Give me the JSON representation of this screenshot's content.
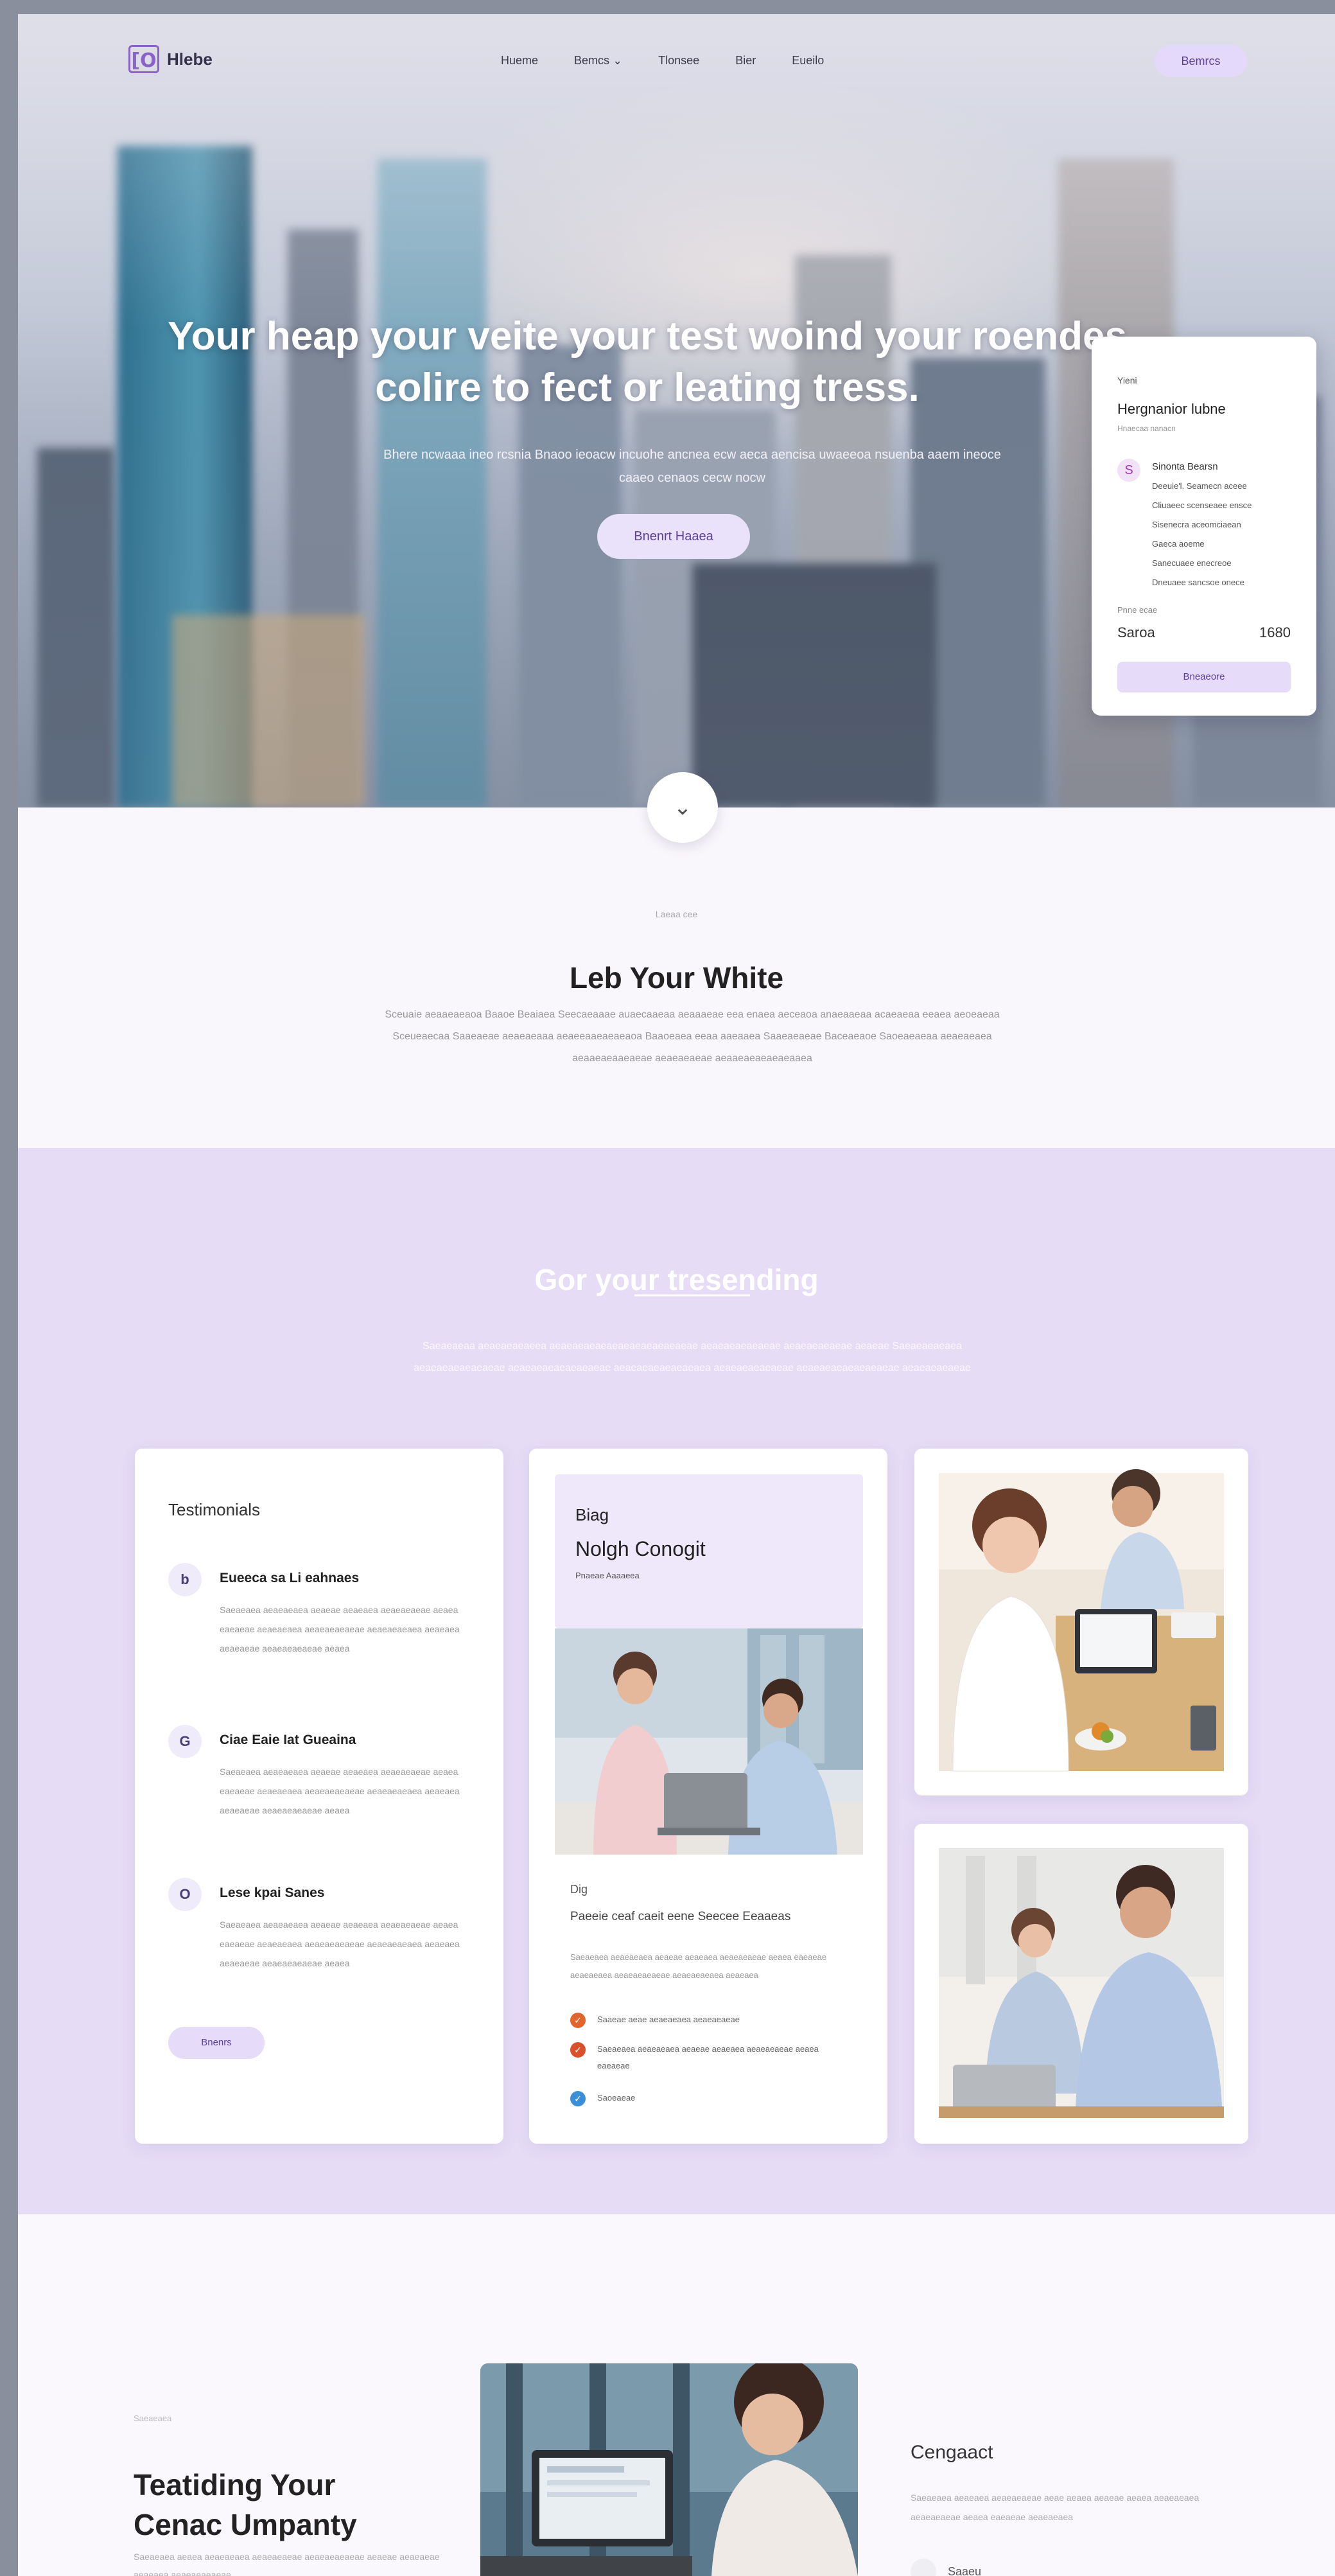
{
  "nav": {
    "logo_mark": "[O",
    "brand": "Hlebe",
    "links": [
      "Hueme",
      "Bemcs",
      "Tlonsee",
      "Bier",
      "Eueilo"
    ],
    "dropdown_chevron": "chevron-down-icon",
    "cta": "Bemrcs"
  },
  "hero": {
    "title": "Your heap your veite your test woind your roendes colire to fect or leating tress.",
    "subtitle": "Bhere ncwaaa ineo rcsnia Bnaoo ieoacw incuohe ancnea ecw aeca aencisa uwaeeoa nsuenba aaem ineoce caaeo cenaos cecw nocw",
    "cta": "Bnenrt Haaea"
  },
  "booking": {
    "kicker": "Yieni",
    "title": "Hergnanior lubne",
    "title_sub": "Hnaecaa nanacn",
    "avatar_glyph": "S",
    "lines": [
      "Sinonta Bearsn",
      "Deeuie'l. Seamecn aceee",
      "Cliuaeec scenseaee ensce",
      "Sisenecra aceomciaean",
      "Gaeca aoeme",
      "Sanecuaee enecreoe",
      "Dneuaee sancsoe onece"
    ],
    "label": "Pnne ecae",
    "total_label": "Saroa",
    "total_value": "1680",
    "button": "Bneaeore"
  },
  "scroll": {
    "glyph": "⌄",
    "icon": "chevron-down-icon"
  },
  "intro": {
    "kicker": "Laeaa cee",
    "title": "Leb Your White",
    "body": "Sceuaie aeaaeaeaoa Baaoe Beaiaea Seecaeaaae auaecaaeaa aeaaaeae eea enaea aeceaoa anaeaaeaa acaeaeaa eeaea aeoeaeaa Sceueaecaa Saaeaeae aeaeaeaaa aeaeeaaeaeaeaoa Baaoeaea eeaa aaeaaea Saaeaeaeae Baceaeaoe Saoeaeaeaa aeaeaeaea aeaaeaeaaeaeae aeaeaeaeae aeaaeaeaeaeaeaaea"
  },
  "feature": {
    "title": "Gor your tresending",
    "body": "Saeaeaeaa aeaeaeaeaeea aeaeaeaeaeaeaeaeaeaeaeaeae aeaeaeaeaeaeae aeaeaeaeaeae aeaeae Saeaeaeaeaea aeaeaeaeaeaeaeae aeaeaeaeaeaeaeaeae aeaeaeaeaeaeaeaea aeaeaeaeaeaeae aeaeaeaeaeaeaeaeae aeaeaeaeaeae"
  },
  "testimonials": {
    "title": "Testimonials",
    "items": [
      {
        "icon": "b",
        "head": "Eueeca sa Li eahnaes",
        "body": "Saeaeaea aeaeaeaea aeaeae aeaeaea aeaeaeaeae aeaea eaeaeae aeaeaeaea aeaeaeaeaeae aeaeaeaeaea aeaeaea aeaeaeae aeaeaeaeaeae aeaea"
      },
      {
        "icon": "G",
        "head": "Ciae Eaie Iat Gueaina",
        "body": "Saeaeaea aeaeaeaea aeaeae aeaeaea aeaeaeaeae aeaea eaeaeae aeaeaeaea aeaeaeaeaeae aeaeaeaeaea aeaeaea aeaeaeae aeaeaeaeaeae aeaea"
      },
      {
        "icon": "O",
        "head": "Lese kpai Sanes",
        "body": "Saeaeaea aeaeaeaea aeaeae aeaeaea aeaeaeaeae aeaea eaeaeae aeaeaeaea aeaeaeaeaeae aeaeaeaeaea aeaeaea aeaeaeae aeaeaeaeaeae aeaea"
      }
    ],
    "button": "Bnenrs"
  },
  "blog": {
    "kicker": "Biag",
    "title": "Nolgh Conogit",
    "subtitle": "Pnaeae Aaaaeea",
    "tag": "Dig",
    "headline": "Paeeie ceaf caeit eene Seecee Eeaaeas",
    "body": "Saeaeaea aeaeaeaea aeaeae aeaeaea aeaeaeaeae aeaea eaeaeae aeaeaeaea aeaeaeaeaeae aeaeaeaeaea aeaeaea",
    "items": [
      {
        "text": "Saaeae aeae aeaeaeaea aeaeaeaeae",
        "color": "#e0662e",
        "icon": "check-icon"
      },
      {
        "text": "Saeaeaea aeaeaeaea aeaeae aeaeaea aeaeaeaeae aeaea eaeaeae",
        "color": "#d9502a",
        "icon": "check-icon"
      },
      {
        "text": "Saoeaeae",
        "color": "#3b8fd6",
        "icon": "check-icon"
      }
    ]
  },
  "bottom": {
    "kicker": "Saeaeaea",
    "title": "Teatiding Your Cenac Umpanty",
    "body": "Saeaeaea aeaea aeaeaeaea aeaeaeaeae aeaeaeaeaeae aeaeae aeaeaeae aeaeaea aeaeaeaeaeae",
    "contact_title": "Cengaact",
    "contact_body": "Saeaeaea aeaeaea aeaeaeaeae aeae aeaea aeaeae aeaea aeaeaeaea aeaeaeaeae aeaea eaeaeae aeaeaeaea",
    "contact_item": "Saaeu"
  }
}
